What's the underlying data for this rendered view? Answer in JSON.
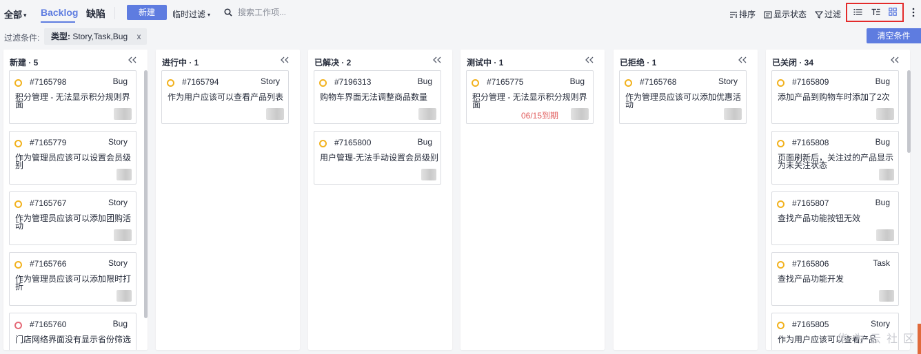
{
  "toolbar": {
    "scope": "全部",
    "tabs": [
      {
        "label": "Backlog",
        "active": true
      },
      {
        "label": "缺陷",
        "active": false
      }
    ],
    "new_button": "新建",
    "temp_filter": "临时过滤",
    "search_placeholder": "搜索工作项...",
    "sort_label": "排序",
    "display_status_label": "显示状态",
    "filter_label": "过滤",
    "view_icons": [
      "list-view-icon",
      "tree-view-icon",
      "board-view-icon"
    ],
    "active_view": "board-view-icon",
    "colors": {
      "primary": "#5e7ce0",
      "highlight_box": "#e32b2b"
    }
  },
  "filter_bar": {
    "label": "过滤条件:",
    "chip_key": "类型:",
    "chip_value": "Story,Task,Bug",
    "chip_close": "x",
    "clear_button": "清空条件"
  },
  "columns": [
    {
      "title": "新建 · 5",
      "cards": [
        {
          "id": "#7165798",
          "type": "Bug",
          "title": "积分管理 - 无法显示积分规则界面",
          "status": "yellow"
        },
        {
          "id": "#7165779",
          "type": "Story",
          "title": "作为管理员应该可以设置会员级别",
          "status": "yellow"
        },
        {
          "id": "#7165767",
          "type": "Story",
          "title": "作为管理员应该可以添加团购活动",
          "status": "yellow"
        },
        {
          "id": "#7165766",
          "type": "Story",
          "title": "作为管理员应该可以添加限时打折",
          "status": "yellow"
        },
        {
          "id": "#7165760",
          "type": "Bug",
          "title": "门店网络界面没有显示省份筛选",
          "status": "red"
        }
      ]
    },
    {
      "title": "进行中 · 1",
      "cards": [
        {
          "id": "#7165794",
          "type": "Story",
          "title": "作为用户应该可以查看产品列表",
          "status": "yellow"
        }
      ]
    },
    {
      "title": "已解决 · 2",
      "cards": [
        {
          "id": "#7196313",
          "type": "Bug",
          "title": "购物车界面无法调整商品数量",
          "status": "yellow"
        },
        {
          "id": "#7165800",
          "type": "Bug",
          "title": "用户管理-无法手动设置会员级别",
          "status": "yellow"
        }
      ]
    },
    {
      "title": "测试中 · 1",
      "cards": [
        {
          "id": "#7165775",
          "type": "Bug",
          "title": "积分管理 - 无法显示积分规则界面",
          "status": "yellow",
          "due": "06/15到期"
        }
      ]
    },
    {
      "title": "已拒绝 · 1",
      "cards": [
        {
          "id": "#7165768",
          "type": "Story",
          "title": "作为管理员应该可以添加优惠活动",
          "status": "yellow"
        }
      ]
    },
    {
      "title": "已关闭 · 34",
      "cards": [
        {
          "id": "#7165809",
          "type": "Bug",
          "title": "添加产品到购物车时添加了2次",
          "status": "yellow"
        },
        {
          "id": "#7165808",
          "type": "Bug",
          "title": "页面刷新后，关注过的产品显示为未关注状态",
          "status": "yellow"
        },
        {
          "id": "#7165807",
          "type": "Bug",
          "title": "查找产品功能按钮无效",
          "status": "yellow"
        },
        {
          "id": "#7165806",
          "type": "Task",
          "title": "查找产品功能开发",
          "status": "yellow"
        },
        {
          "id": "#7165805",
          "type": "Story",
          "title": "作为用户应该可以查看产品",
          "status": "yellow"
        }
      ]
    }
  ],
  "watermark": "华为云社区"
}
